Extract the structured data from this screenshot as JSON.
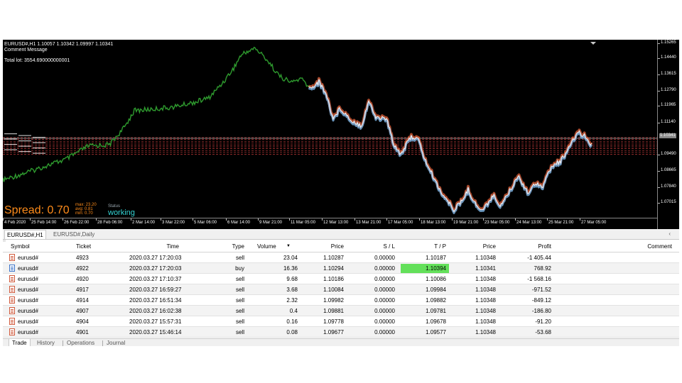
{
  "chart": {
    "info_line1": "EURUSD#,H1  1.10057 1.10342 1.09997 1.10341",
    "info_line2": "Comment Message",
    "info_line3": "Total lot: 3554.690000000001",
    "spread_label": "Spread: 0.70",
    "stats": {
      "max": "max:  23.20",
      "avg": "avg:   0.81",
      "min": "min:   0.70"
    },
    "status_label": "Status",
    "status_value": "working",
    "y_labels": [
      "1.15265",
      "1.14440",
      "1.13615",
      "1.12790",
      "1.11965",
      "1.11140",
      "1.10341",
      "1.09490",
      "1.08665",
      "1.07840",
      "1.07015"
    ],
    "x_labels": [
      "4 Feb 2020",
      "25 Feb 14:00",
      "26 Feb 22:00",
      "28 Feb 06:00",
      "2 Mar 14:00",
      "3 Mar 22:00",
      "5 Mar 06:00",
      "6 Mar 14:00",
      "9 Mar 21:00",
      "11 Mar 05:00",
      "12 Mar 13:00",
      "13 Mar 21:00",
      "17 Mar 05:00",
      "18 Mar 13:00",
      "19 Mar 21:00",
      "23 Mar 05:00",
      "24 Mar 13:00",
      "25 Mar 21:00",
      "27 Mar 05:00"
    ],
    "colors": {
      "background": "#000000",
      "bull_line": "#2e9a2e",
      "sell_marker": "#e0603a",
      "buy_marker": "#7fb8e8",
      "level_line": "#c23b3b"
    }
  },
  "chart_tabs": [
    "EURUSD#,H1",
    "EURUSD#,Daily"
  ],
  "table": {
    "columns": [
      "Symbol",
      "Ticket",
      "Time",
      "Type",
      "Volume",
      "Price",
      "S / L",
      "T / P",
      "Price",
      "Profit",
      "Comment"
    ],
    "sort_indicator": "▼",
    "rows": [
      [
        "eurusd#",
        "4923",
        "2020.03.27 17:20:03",
        "sell",
        "23.04",
        "1.10287",
        "0.00000",
        "1.10187",
        "1.10348",
        "-1 405.44",
        ""
      ],
      [
        "eurusd#",
        "4922",
        "2020.03.27 17:20:03",
        "buy",
        "16.36",
        "1.10294",
        "0.00000",
        "1.10394",
        "1.10341",
        "768.92",
        ""
      ],
      [
        "eurusd#",
        "4920",
        "2020.03.27 17:10:37",
        "sell",
        "9.68",
        "1.10186",
        "0.00000",
        "1.10086",
        "1.10348",
        "-1 568.16",
        ""
      ],
      [
        "eurusd#",
        "4917",
        "2020.03.27 16:59:27",
        "sell",
        "3.68",
        "1.10084",
        "0.00000",
        "1.09984",
        "1.10348",
        "-971.52",
        ""
      ],
      [
        "eurusd#",
        "4914",
        "2020.03.27 16:51:34",
        "sell",
        "2.32",
        "1.09982",
        "0.00000",
        "1.09882",
        "1.10348",
        "-849.12",
        ""
      ],
      [
        "eurusd#",
        "4907",
        "2020.03.27 16:02:38",
        "sell",
        "0.4",
        "1.09881",
        "0.00000",
        "1.09781",
        "1.10348",
        "-186.80",
        ""
      ],
      [
        "eurusd#",
        "4904",
        "2020.03.27 15:57:31",
        "sell",
        "0.16",
        "1.09778",
        "0.00000",
        "1.09678",
        "1.10348",
        "-91.20",
        ""
      ],
      [
        "eurusd#",
        "4901",
        "2020.03.27 15:46:14",
        "sell",
        "0.08",
        "1.09677",
        "0.00000",
        "1.09577",
        "1.10348",
        "-53.68",
        ""
      ]
    ],
    "highlight_color": "#63e05a"
  },
  "bottom_tabs": [
    "Trade",
    "History",
    "Operations",
    "Journal"
  ]
}
